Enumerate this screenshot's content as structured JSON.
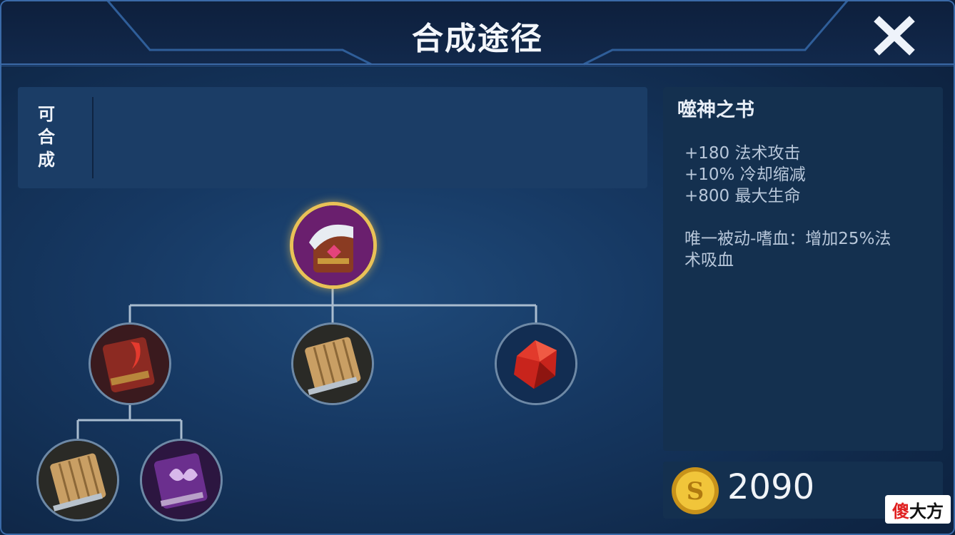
{
  "header": {
    "title": "合成途径"
  },
  "craftable": {
    "label_chars": [
      "可",
      "合",
      "成"
    ]
  },
  "tree": {
    "root": {
      "icon": "tome-icon"
    },
    "children": [
      {
        "icon": "red-book-icon"
      },
      {
        "icon": "wooden-book-icon"
      },
      {
        "icon": "red-crystal-icon"
      }
    ],
    "grandchildren": [
      {
        "icon": "wooden-book-icon"
      },
      {
        "icon": "purple-book-icon"
      }
    ]
  },
  "item_info": {
    "name": "噬神之书",
    "stats": [
      "+180 法术攻击",
      "+10% 冷却缩减",
      "+800 最大生命"
    ],
    "passive_lines": [
      "唯一被动-嗜血：增加25%法",
      "术吸血"
    ]
  },
  "price": {
    "value": "2090",
    "icon": "gold-coin-icon"
  },
  "watermark": {
    "part1": "傻",
    "part2": "大方"
  },
  "colors": {
    "root_ring": "#e9c157",
    "coin": "#e8b923",
    "accent": "#3b6aa8"
  }
}
